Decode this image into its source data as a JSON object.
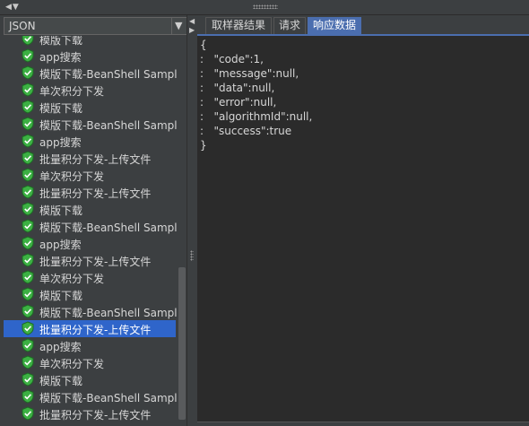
{
  "toolbar": {
    "collapse_arrows": "◀▼",
    "grip_icon": "grip-icon"
  },
  "renderer_select": {
    "value": "JSON",
    "arrow": "▼"
  },
  "tree": {
    "icon": "check-shield-icon",
    "icon_color": "#3cb043",
    "selected_index": 17,
    "items": [
      "模版下载",
      "app搜索",
      "模版下载-BeanShell Sampler",
      "单次积分下发",
      "模版下载",
      "模版下载-BeanShell Sampler",
      "app搜索",
      "批量积分下发-上传文件",
      "单次积分下发",
      "批量积分下发-上传文件",
      "模版下载",
      "模版下载-BeanShell Sampler",
      "app搜索",
      "批量积分下发-上传文件",
      "单次积分下发",
      "模版下载",
      "模版下载-BeanShell Sampler",
      "批量积分下发-上传文件",
      "app搜索",
      "单次积分下发",
      "模版下载",
      "模版下载-BeanShell Sampler",
      "批量积分下发-上传文件"
    ]
  },
  "splitter": {
    "left_arrow": "◀",
    "right_arrow": "▶"
  },
  "tabs": [
    {
      "label": "取样器结果",
      "active": false
    },
    {
      "label": "请求",
      "active": false
    },
    {
      "label": "响应数据",
      "active": true
    }
  ],
  "response": {
    "lines": [
      "{",
      ":   \"code\":1,",
      ":   \"message\":null,",
      ":   \"data\":null,",
      ":   \"error\":null,",
      ":   \"algorithmId\":null,",
      ":   \"success\":true",
      "}"
    ]
  }
}
